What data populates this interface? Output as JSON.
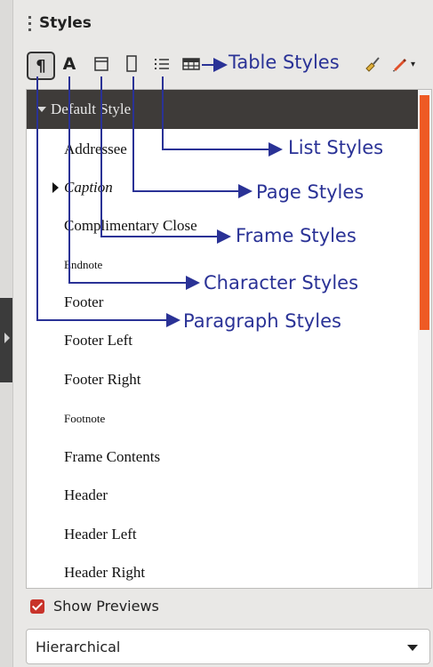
{
  "panel": {
    "title": "Styles",
    "close_glyph": "×"
  },
  "toolbar": {
    "buttons": [
      {
        "name": "paragraph-styles",
        "icon": "pilcrow-icon",
        "glyph": "¶",
        "selected": true
      },
      {
        "name": "character-styles",
        "icon": "character-a-icon",
        "glyph": "A"
      },
      {
        "name": "frame-styles",
        "icon": "frame-icon"
      },
      {
        "name": "page-styles",
        "icon": "page-icon"
      },
      {
        "name": "list-styles",
        "icon": "list-icon"
      },
      {
        "name": "table-styles",
        "icon": "table-icon"
      },
      {
        "name": "fill-format-mode",
        "icon": "paint-bucket-icon"
      },
      {
        "name": "styles-actions",
        "icon": "new-style-icon"
      }
    ]
  },
  "styles_list": {
    "items": [
      {
        "label": "Default Style",
        "selected": true,
        "expanded": true
      },
      {
        "label": "Addressee"
      },
      {
        "label": "Caption",
        "italic": true,
        "collapsed": true
      },
      {
        "label": "Complimentary Close"
      },
      {
        "label": "Endnote",
        "small": true
      },
      {
        "label": "Footer"
      },
      {
        "label": "Footer Left"
      },
      {
        "label": "Footer Right"
      },
      {
        "label": "Footnote",
        "small": true
      },
      {
        "label": "Frame Contents"
      },
      {
        "label": "Header"
      },
      {
        "label": "Header Left"
      },
      {
        "label": "Header Right"
      }
    ]
  },
  "show_previews": {
    "label": "Show Previews",
    "checked": true
  },
  "filter": {
    "selected": "Hierarchical"
  },
  "annotations": {
    "color": "#2a3296",
    "table_styles": "Table Styles",
    "list_styles": "List Styles",
    "page_styles": "Page Styles",
    "frame_styles": "Frame Styles",
    "character_styles": "Character Styles",
    "paragraph_styles": "Paragraph Styles"
  },
  "colors": {
    "accent": "#ee5a24",
    "selection": "#3e3b39",
    "checkbox": "#c8332a"
  }
}
